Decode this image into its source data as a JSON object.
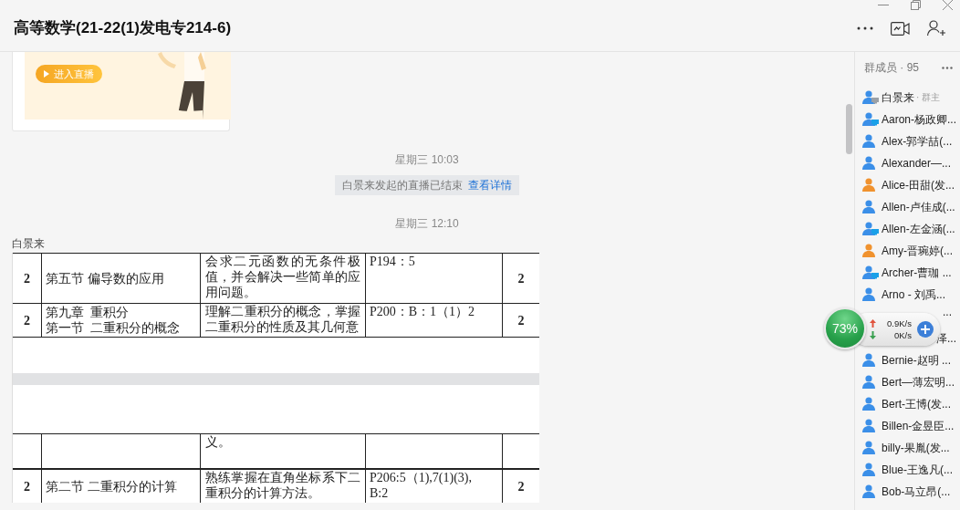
{
  "window": {
    "title": "高等数学(21-22(1)发电专214-6)"
  },
  "chat": {
    "messages": [
      {
        "kind": "live_card",
        "button": "进入直播"
      },
      {
        "kind": "timestamp",
        "text": "星期三 10:03"
      },
      {
        "kind": "notice",
        "text": "白景来发起的直播已结束",
        "link": "查看详情"
      },
      {
        "kind": "timestamp",
        "text": "星期三 12:10"
      },
      {
        "kind": "sender",
        "text": "白景来"
      },
      {
        "kind": "document",
        "rows": [
          {
            "kind": "row",
            "column_1": "2",
            "column_2": "第五节  偏导数的应用",
            "column_3": "会求二元函数的无条件极值，并会解决一些简单的应用问题。",
            "column_4": "P194：5",
            "column_5": "2"
          },
          {
            "kind": "row",
            "column_1": "2",
            "column_2": [
              "第九章  重积分",
              "第一节  二重积分的概念"
            ],
            "column_3": "理解二重积分的概念，掌握二重积分的性质及其几何意",
            "column_4": "P200：B：1（1）2",
            "column_5": "2"
          },
          {
            "kind": "page_break"
          },
          {
            "kind": "row",
            "column_3": "义。"
          },
          {
            "kind": "row",
            "column_1": "2",
            "column_2": "第二节  二重积分的计算",
            "column_3": "熟练掌握在直角坐标系下二重积分的计算方法。",
            "column_4": "P206:5（1),7(1)(3),\nB:2",
            "column_5": "2"
          }
        ]
      }
    ]
  },
  "members": {
    "title": "群成员 · 95",
    "items": [
      {
        "kind": "member",
        "name": "白景来",
        "role": "· 群主",
        "color": "#3b8fe8",
        "pc": true,
        "pc_active": false
      },
      {
        "kind": "member",
        "name": "Aaron-杨政卿...",
        "color": "#3b8fe8",
        "pc": true,
        "pc_active": true
      },
      {
        "kind": "member",
        "name": "Alex-郭学喆(...",
        "color": "#3b8fe8",
        "pc": false
      },
      {
        "kind": "member",
        "name": "Alexander—...",
        "color": "#3b8fe8",
        "pc": false
      },
      {
        "kind": "member",
        "name": "Alice-田甜(发...",
        "color": "#f0922e",
        "pc": false
      },
      {
        "kind": "member",
        "name": "Allen-卢佳成(...",
        "color": "#3b8fe8",
        "pc": false
      },
      {
        "kind": "member",
        "name": "Allen-左金涵(...",
        "color": "#3b8fe8",
        "pc": true,
        "pc_active": true
      },
      {
        "kind": "member",
        "name": "Amy-晋琬婷(...",
        "color": "#f0922e",
        "pc": false
      },
      {
        "kind": "member",
        "name": "Archer-曹珈  ...",
        "color": "#3b8fe8",
        "pc": true,
        "pc_active": true
      },
      {
        "kind": "member",
        "name": "Arno  -  刘禹...",
        "color": "#3b8fe8",
        "pc": false
      },
      {
        "kind": "covered",
        "name": "..."
      },
      {
        "kind": "covered",
        "name": "泽..."
      },
      {
        "kind": "member",
        "name": "Bernie-赵明  ...",
        "color": "#3b8fe8",
        "pc": false
      },
      {
        "kind": "member",
        "name": "Bert—薄宏明...",
        "color": "#3b8fe8",
        "pc": false
      },
      {
        "kind": "member",
        "name": "Bert-王博(发...",
        "color": "#3b8fe8",
        "pc": false
      },
      {
        "kind": "member",
        "name": "Billen-金昱臣...",
        "color": "#3b8fe8",
        "pc": false
      },
      {
        "kind": "member",
        "name": "billy-果胤(发...",
        "color": "#3b8fe8",
        "pc": false
      },
      {
        "kind": "member",
        "name": "Blue-王逸凡(...",
        "color": "#3b8fe8",
        "pc": false
      },
      {
        "kind": "member",
        "name": "Bob-马立昂(...",
        "color": "#3b8fe8",
        "pc": false
      }
    ]
  },
  "speed_widget": {
    "percent": "73%",
    "upload": "0.9K/s",
    "download": "0K/s"
  }
}
